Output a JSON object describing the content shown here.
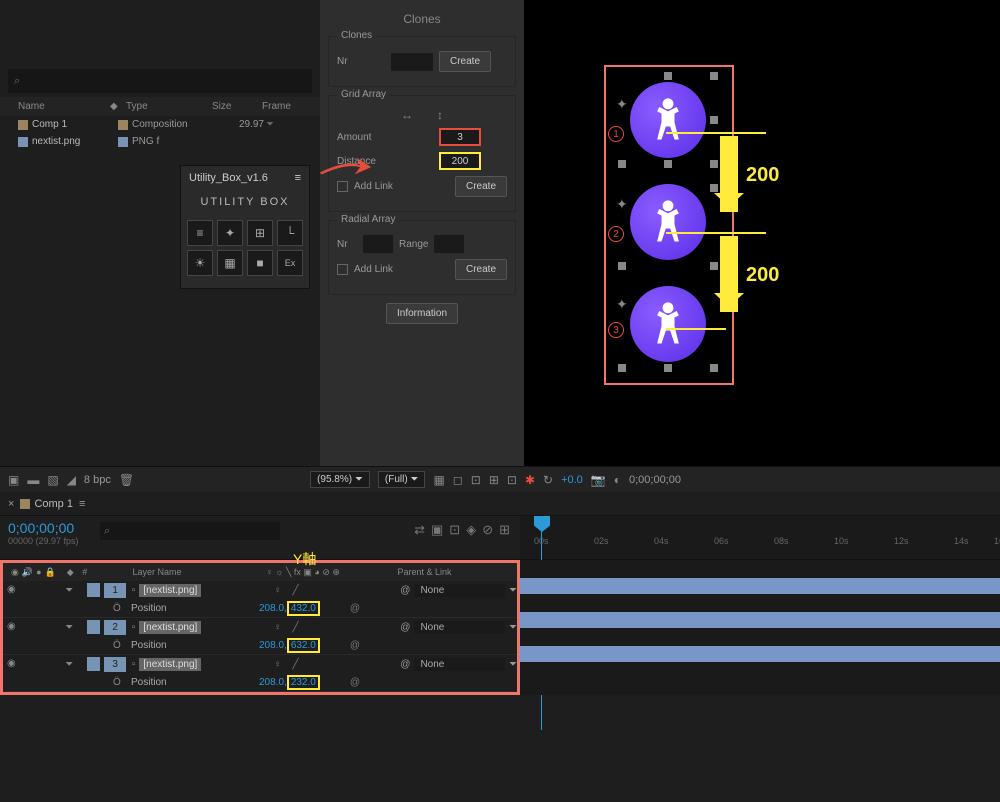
{
  "project": {
    "headers": {
      "name": "Name",
      "type": "Type",
      "size": "Size",
      "frame": "Frame"
    },
    "rows": [
      {
        "name": "Comp 1",
        "type": "Composition",
        "fps": "29.97"
      },
      {
        "name": "nextist.png",
        "type": "PNG f",
        "fps": ""
      }
    ],
    "search": "⌕"
  },
  "utility": {
    "title": "Utility_Box_v1.6",
    "subtitle": "UTILITY BOX",
    "menu": "≡"
  },
  "clones": {
    "panel_title": "Clones",
    "clones": {
      "label": "Clones",
      "nr": "Nr",
      "create": "Create"
    },
    "grid": {
      "label": "Grid Array",
      "arrow_h": "↔",
      "arrow_v": "↕",
      "amount_label": "Amount",
      "amount": "3",
      "distance_label": "Distance",
      "distance": "200",
      "addlink": "Add Link",
      "create": "Create"
    },
    "radial": {
      "label": "Radial Array",
      "nr": "Nr",
      "range": "Range",
      "addlink": "Add Link",
      "create": "Create"
    },
    "info": "Information"
  },
  "viewer": {
    "labels": {
      "d1": "200",
      "d2": "200"
    },
    "nums": [
      "1",
      "2",
      "3"
    ]
  },
  "footer": {
    "bpc": "8 bpc",
    "zoom": "(95.8%)",
    "res": "(Full)",
    "delta": "+0.0",
    "tc": "0;00;00;00"
  },
  "timeline": {
    "tab": "Comp 1",
    "close": "×",
    "menu": "≡",
    "tc": "0;00;00;00",
    "tc_sub": "00000 (29.97 fps)",
    "ruler": [
      "00s",
      "02s",
      "04s",
      "06s",
      "08s",
      "10s",
      "12s",
      "14s",
      "16"
    ],
    "columns": {
      "layer": "Layer Name",
      "parent": "Parent & Link",
      "num": "#"
    },
    "yaxis": "Y軸",
    "layers": [
      {
        "n": "1",
        "name": "[nextist.png]",
        "prop": "Position",
        "x": "208.0",
        "y": "432.0",
        "parent": "None"
      },
      {
        "n": "2",
        "name": "[nextist.png]",
        "prop": "Position",
        "x": "208.0",
        "y": "632.0",
        "parent": "None"
      },
      {
        "n": "3",
        "name": "[nextist.png]",
        "prop": "Position",
        "x": "208.0",
        "y": "232.0",
        "parent": "None"
      }
    ]
  }
}
